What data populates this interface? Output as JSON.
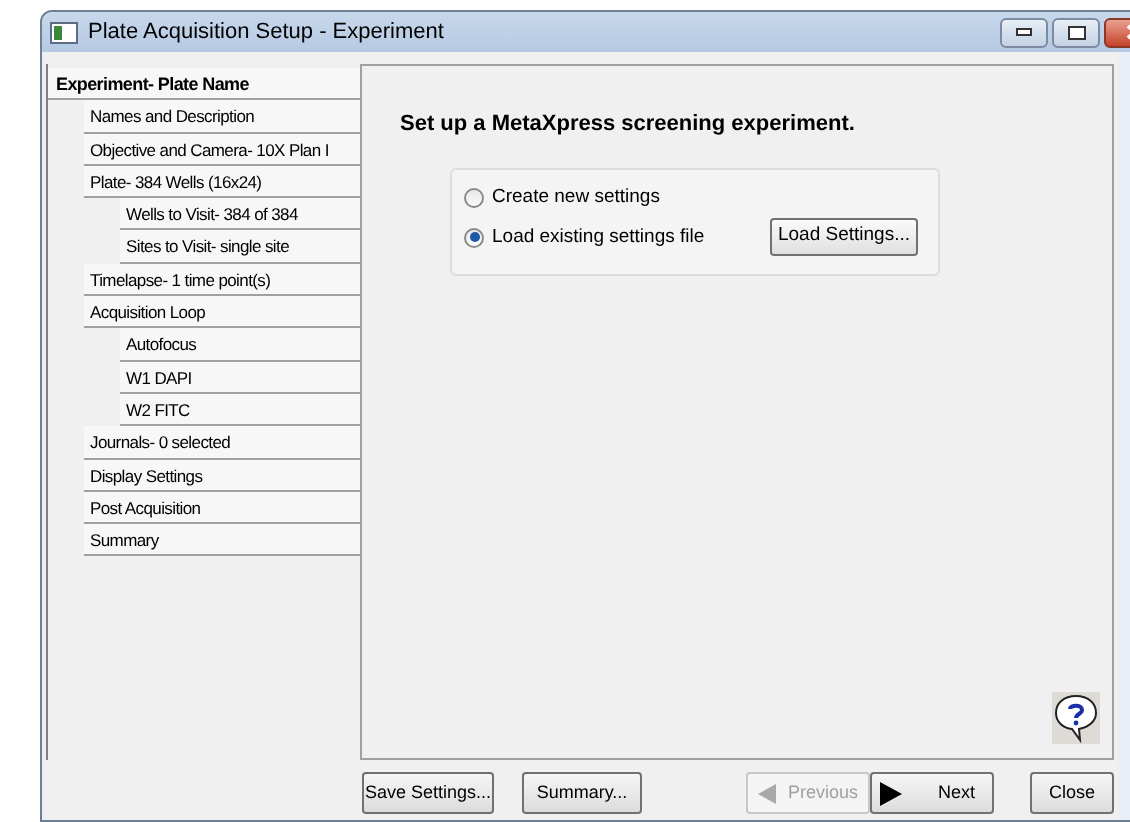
{
  "window": {
    "title": "Plate Acquisition Setup - Experiment"
  },
  "tree": [
    {
      "label": "Experiment- Plate Name",
      "children": [
        {
          "label": "Names and Description"
        },
        {
          "label": "Objective and Camera- 10X Plan I"
        },
        {
          "label": "Plate- 384 Wells (16x24)",
          "children": [
            {
              "label": "Wells to Visit- 384 of 384"
            },
            {
              "label": "Sites to Visit- single site"
            }
          ]
        },
        {
          "label": "Timelapse- 1 time point(s)"
        },
        {
          "label": "Acquisition Loop",
          "children": [
            {
              "label": "Autofocus"
            },
            {
              "label": "W1 DAPI"
            },
            {
              "label": "W2 FITC"
            }
          ]
        },
        {
          "label": "Journals- 0 selected"
        },
        {
          "label": "Display Settings"
        },
        {
          "label": "Post Acquisition"
        },
        {
          "label": "Summary"
        }
      ]
    }
  ],
  "heading": "Set up a MetaXpress screening experiment.",
  "options": [
    {
      "label": "Create new settings",
      "selected": false
    },
    {
      "label": "Load existing settings file",
      "selected": true
    }
  ],
  "load_button": "Load Settings...",
  "buttons": [
    {
      "label": "Save Settings...",
      "kind": "button",
      "disabled": false
    },
    {
      "label": "Summary...",
      "kind": "button",
      "disabled": false
    },
    {
      "label": "Previous",
      "kind": "previous",
      "disabled": true
    },
    {
      "label": "Next",
      "kind": "next",
      "disabled": false
    },
    {
      "label": "Close",
      "kind": "button",
      "disabled": false
    }
  ]
}
